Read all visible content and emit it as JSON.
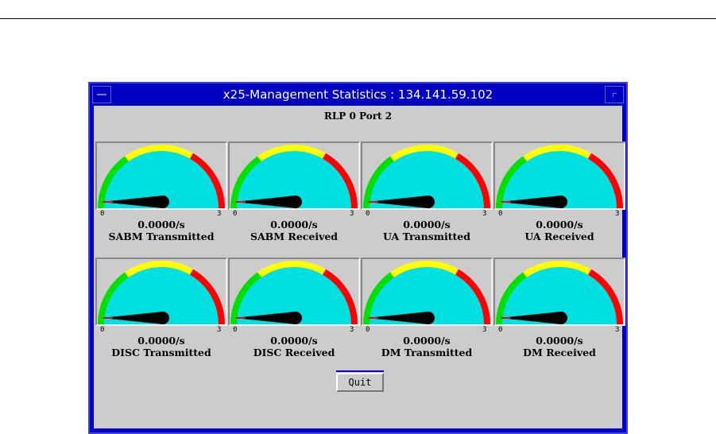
{
  "window": {
    "title": "x25-Management Statistics : 134.141.59.102",
    "heading": "RLP 0 Port 2"
  },
  "scale": {
    "min": "0",
    "max": "3"
  },
  "colors": {
    "face": "#00e0e0",
    "green": "#00e000",
    "yellow": "#ffff00",
    "red": "#ff0000",
    "needle": "#000000"
  },
  "gauges": [
    {
      "value": "0.0000/s",
      "label": "SABM Transmitted",
      "reading": 0
    },
    {
      "value": "0.0000/s",
      "label": "SABM Received",
      "reading": 0
    },
    {
      "value": "0.0000/s",
      "label": "UA Transmitted",
      "reading": 0
    },
    {
      "value": "0.0000/s",
      "label": "UA Received",
      "reading": 0
    },
    {
      "value": "0.0000/s",
      "label": "DISC Transmitted",
      "reading": 0
    },
    {
      "value": "0.0000/s",
      "label": "DISC Received",
      "reading": 0
    },
    {
      "value": "0.0000/s",
      "label": "DM Transmitted",
      "reading": 0
    },
    {
      "value": "0.0000/s",
      "label": "DM Received",
      "reading": 0
    }
  ],
  "quit_label": "Quit"
}
